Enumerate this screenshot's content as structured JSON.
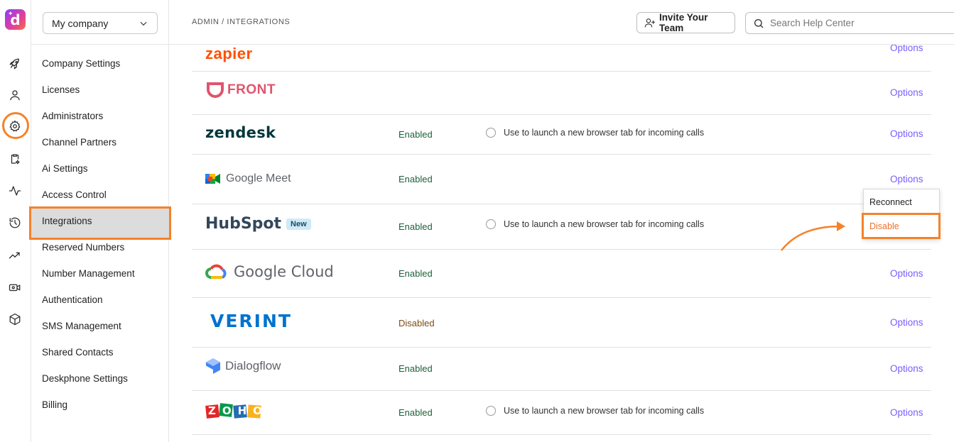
{
  "app": {
    "logo_letter": "d",
    "colors": {
      "accent": "#f5822a",
      "link": "#7a5cff",
      "enabled": "#1d5f3a",
      "disabled": "#7a4d12"
    }
  },
  "rail": {
    "icons": [
      "rocket-icon",
      "user-icon",
      "gear-icon",
      "clipboard-sparkle-icon",
      "activity-icon",
      "history-icon",
      "trending-icon",
      "video-settings-icon",
      "cube-icon"
    ],
    "active_icon": "gear-icon"
  },
  "sidebar": {
    "company": "My company",
    "items": [
      {
        "label": "Company Settings"
      },
      {
        "label": "Licenses"
      },
      {
        "label": "Administrators"
      },
      {
        "label": "Channel Partners"
      },
      {
        "label": "Ai Settings"
      },
      {
        "label": "Access Control"
      },
      {
        "label": "Integrations",
        "active": true
      },
      {
        "label": "Reserved Numbers"
      },
      {
        "label": "Number Management"
      },
      {
        "label": "Authentication"
      },
      {
        "label": "SMS Management"
      },
      {
        "label": "Shared Contacts"
      },
      {
        "label": "Deskphone Settings"
      },
      {
        "label": "Billing"
      }
    ]
  },
  "topbar": {
    "breadcrumb": "ADMIN / INTEGRATIONS",
    "invite_label": "Invite Your Team",
    "search_placeholder": "Search Help Center"
  },
  "integrations": [
    {
      "name": "zapier",
      "status": "",
      "launch_option": "",
      "options_label": "Options"
    },
    {
      "name": "FRONT",
      "status": "",
      "launch_option": "",
      "options_label": "Options"
    },
    {
      "name": "zendesk",
      "status": "Enabled",
      "launch_option": "Use to launch a new browser tab for incoming calls",
      "options_label": "Options"
    },
    {
      "name": "Google Meet",
      "status": "Enabled",
      "launch_option": "",
      "options_label": "Options"
    },
    {
      "name": "HubSpot",
      "badge": "New",
      "status": "Enabled",
      "launch_option": "Use to launch a new browser tab for incoming calls",
      "options_label": ""
    },
    {
      "name": "Google Cloud",
      "status": "Enabled",
      "launch_option": "",
      "options_label": "Options"
    },
    {
      "name": "VERINT",
      "status": "Disabled",
      "launch_option": "",
      "options_label": "Options"
    },
    {
      "name": "Dialogflow",
      "status": "Enabled",
      "launch_option": "",
      "options_label": "Options"
    },
    {
      "name": "ZOHO",
      "status": "Enabled",
      "launch_option": "Use to launch a new browser tab for incoming calls",
      "options_label": "Options"
    }
  ],
  "options_menu": {
    "items": [
      "Reconnect",
      "Disable"
    ],
    "highlighted": "Disable"
  }
}
